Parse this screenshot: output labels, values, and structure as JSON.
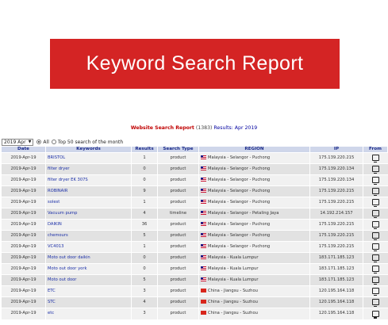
{
  "banner": {
    "title": "Keyword Search Report"
  },
  "report": {
    "title": "Website Search Report",
    "count": "(1383)",
    "results_label": "Results: Apr 2019"
  },
  "filters": {
    "month_value": "2019 Apr",
    "all_label": "All",
    "top50_label": "Top 50 search of the month",
    "selected": "All"
  },
  "table": {
    "headers": [
      "Date",
      "Keywords",
      "Results",
      "Search Type",
      "REGION",
      "IP",
      "From"
    ],
    "rows": [
      {
        "date": "2019-Apr-19",
        "keyword": "BRISTOL",
        "results": "1",
        "type": "product",
        "flag": "my",
        "region": "Malaysia - Selangor - Puchong",
        "ip": "175.139.220.215",
        "from": "monitor-icon"
      },
      {
        "date": "2019-Apr-19",
        "keyword": "filter dryer",
        "results": "0",
        "type": "product",
        "flag": "my",
        "region": "Malaysia - Selangor - Puchong",
        "ip": "175.139.220.134",
        "from": "monitor-icon"
      },
      {
        "date": "2019-Apr-19",
        "keyword": "filter dryer EK 307S",
        "results": "0",
        "type": "product",
        "flag": "my",
        "region": "Malaysia - Selangor - Puchong",
        "ip": "175.139.220.134",
        "from": "monitor-icon"
      },
      {
        "date": "2019-Apr-19",
        "keyword": "ROBINAIR",
        "results": "9",
        "type": "product",
        "flag": "my",
        "region": "Malaysia - Selangor - Puchong",
        "ip": "175.139.220.215",
        "from": "monitor-icon"
      },
      {
        "date": "2019-Apr-19",
        "keyword": "solest",
        "results": "1",
        "type": "product",
        "flag": "my",
        "region": "Malaysia - Selangor - Puchong",
        "ip": "175.139.220.215",
        "from": "monitor-icon"
      },
      {
        "date": "2019-Apr-19",
        "keyword": "Vacuum pump",
        "results": "4",
        "type": "timeline",
        "flag": "my",
        "region": "Malaysia - Selangor - Petaling Jaya",
        "ip": "14.192.214.157",
        "from": "monitor-icon"
      },
      {
        "date": "2019-Apr-19",
        "keyword": "DAIKIN",
        "results": "36",
        "type": "product",
        "flag": "my",
        "region": "Malaysia - Selangor - Puchong",
        "ip": "175.139.220.215",
        "from": "monitor-icon"
      },
      {
        "date": "2019-Apr-19",
        "keyword": "chemours",
        "results": "5",
        "type": "product",
        "flag": "my",
        "region": "Malaysia - Selangor - Puchong",
        "ip": "175.139.220.215",
        "from": "monitor-icon"
      },
      {
        "date": "2019-Apr-19",
        "keyword": "VC4013",
        "results": "1",
        "type": "product",
        "flag": "my",
        "region": "Malaysia - Selangor - Puchong",
        "ip": "175.139.220.215",
        "from": "monitor-icon"
      },
      {
        "date": "2019-Apr-19",
        "keyword": "Moto out door daikin",
        "results": "0",
        "type": "product",
        "flag": "my",
        "region": "Malaysia - Kuala Lumpur",
        "ip": "183.171.185.123",
        "from": "monitor-icon"
      },
      {
        "date": "2019-Apr-19",
        "keyword": "Moto out door york",
        "results": "0",
        "type": "product",
        "flag": "my",
        "region": "Malaysia - Kuala Lumpur",
        "ip": "183.171.185.123",
        "from": "monitor-icon"
      },
      {
        "date": "2019-Apr-19",
        "keyword": "Moto out door",
        "results": "5",
        "type": "product",
        "flag": "my",
        "region": "Malaysia - Kuala Lumpur",
        "ip": "183.171.185.123",
        "from": "monitor-icon"
      },
      {
        "date": "2019-Apr-19",
        "keyword": "ETC",
        "results": "3",
        "type": "product",
        "flag": "cn",
        "region": "China - Jiangsu - Suzhou",
        "ip": "120.195.164.118",
        "from": "monitor-icon"
      },
      {
        "date": "2019-Apr-19",
        "keyword": "STC",
        "results": "4",
        "type": "product",
        "flag": "cn",
        "region": "China - Jiangsu - Suzhou",
        "ip": "120.195.164.118",
        "from": "monitor-icon"
      },
      {
        "date": "2019-Apr-19",
        "keyword": "etc",
        "results": "3",
        "type": "product",
        "flag": "cn",
        "region": "China - Jiangsu - Suzhou",
        "ip": "120.195.164.118",
        "from": "monitor-icon"
      }
    ]
  }
}
